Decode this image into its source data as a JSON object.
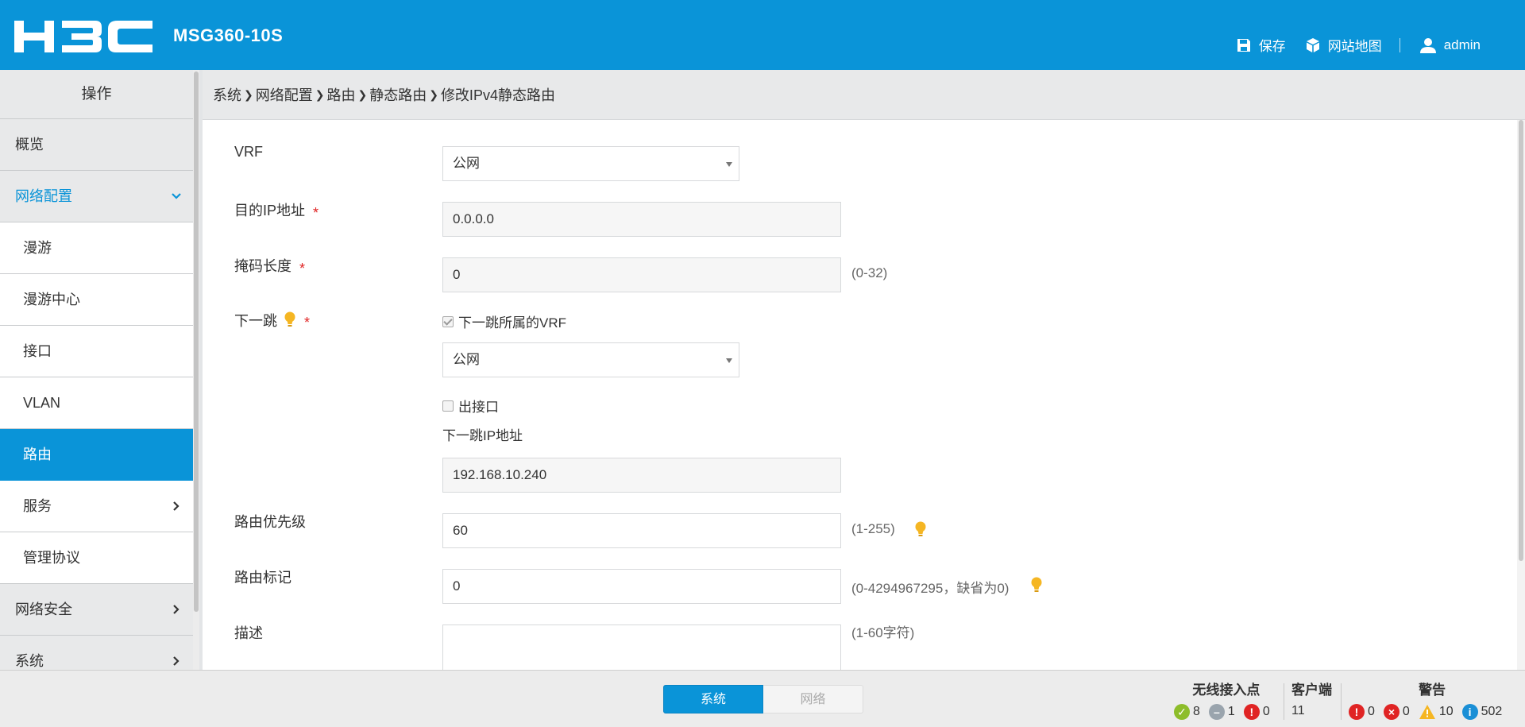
{
  "header": {
    "brand": "H3C",
    "model": "MSG360-10S",
    "save_label": "保存",
    "sitemap_label": "网站地图",
    "user_label": "admin"
  },
  "sidebar": {
    "title": "操作",
    "items": [
      {
        "label": "概览"
      },
      {
        "label": "网络配置"
      },
      {
        "label": "漫游"
      },
      {
        "label": "漫游中心"
      },
      {
        "label": "接口"
      },
      {
        "label": "VLAN"
      },
      {
        "label": "路由"
      },
      {
        "label": "服务"
      },
      {
        "label": "管理协议"
      },
      {
        "label": "网络安全"
      },
      {
        "label": "系统"
      }
    ]
  },
  "breadcrumb": [
    "系统",
    "网络配置",
    "路由",
    "静态路由",
    "修改IPv4静态路由"
  ],
  "form": {
    "vrf": {
      "label": "VRF",
      "value": "公网"
    },
    "dest_ip": {
      "label": "目的IP地址",
      "value": "0.0.0.0"
    },
    "mask_len": {
      "label": "掩码长度",
      "value": "0",
      "hint": "(0-32)"
    },
    "next_hop": {
      "label": "下一跳",
      "vrf_checkbox_label": "下一跳所属的VRF",
      "vrf_value": "公网",
      "out_if_checkbox_label": "出接口",
      "ip_label": "下一跳IP地址",
      "ip_value": "192.168.10.240"
    },
    "priority": {
      "label": "路由优先级",
      "value": "60",
      "hint": "(1-255)"
    },
    "tag": {
      "label": "路由标记",
      "value": "0",
      "hint": "(0-4294967295，缺省为0)"
    },
    "desc": {
      "label": "描述",
      "value": "",
      "hint": "(1-60字符)"
    },
    "required_mark": "*"
  },
  "footer": {
    "tab_system": "系统",
    "tab_network": "网络",
    "ap": {
      "title": "无线接入点",
      "online": "8",
      "offline": "1",
      "fault": "0"
    },
    "clients": {
      "title": "客户端",
      "count": "11"
    },
    "alarms": {
      "title": "警告",
      "critical": "0",
      "major": "0",
      "minor": "10",
      "info": "502"
    }
  },
  "colors": {
    "accent": "#0a94d8",
    "required": "#e02424",
    "bulb": "#f5b623"
  }
}
